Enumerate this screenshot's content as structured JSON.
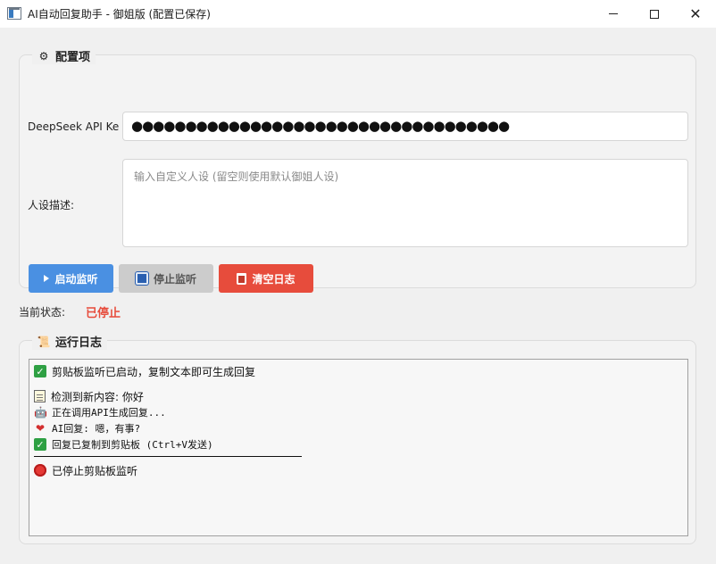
{
  "window": {
    "title": "AI自动回复助手 - 御姐版 (配置已保存)",
    "controls": {
      "minimize": "—",
      "maximize": "□",
      "close": "✕"
    }
  },
  "config": {
    "title": "配置项",
    "icon": "gear-icon",
    "api_label": "DeepSeek API Ke",
    "api_value": "●●●●●●●●●●●●●●●●●●●●●●●●●●●●●●●●●●●",
    "persona_label": "人设描述:",
    "persona_placeholder": "输入自定义人设 (留空则使用默认御姐人设)",
    "buttons": {
      "start": "启动监听",
      "stop": "停止监听",
      "clear": "清空日志"
    }
  },
  "status": {
    "label": "当前状态:",
    "value": "已停止",
    "color": "#e74c3c"
  },
  "logs": {
    "title": "运行日志",
    "icon": "scroll-icon",
    "entries": {
      "started": "剪贴板监听已启动，复制文本即可生成回复",
      "detected": "检测到新内容: 你好",
      "calling": "正在调用API生成回复...",
      "reply": "AI回复: 嗯，有事?",
      "copied": "回复已复制到剪贴板 (Ctrl+V发送)",
      "stopped": "已停止剪贴板监听"
    }
  },
  "colors": {
    "start": "#4a90e2",
    "stop": "#cccccc",
    "clear": "#e74c3c"
  }
}
